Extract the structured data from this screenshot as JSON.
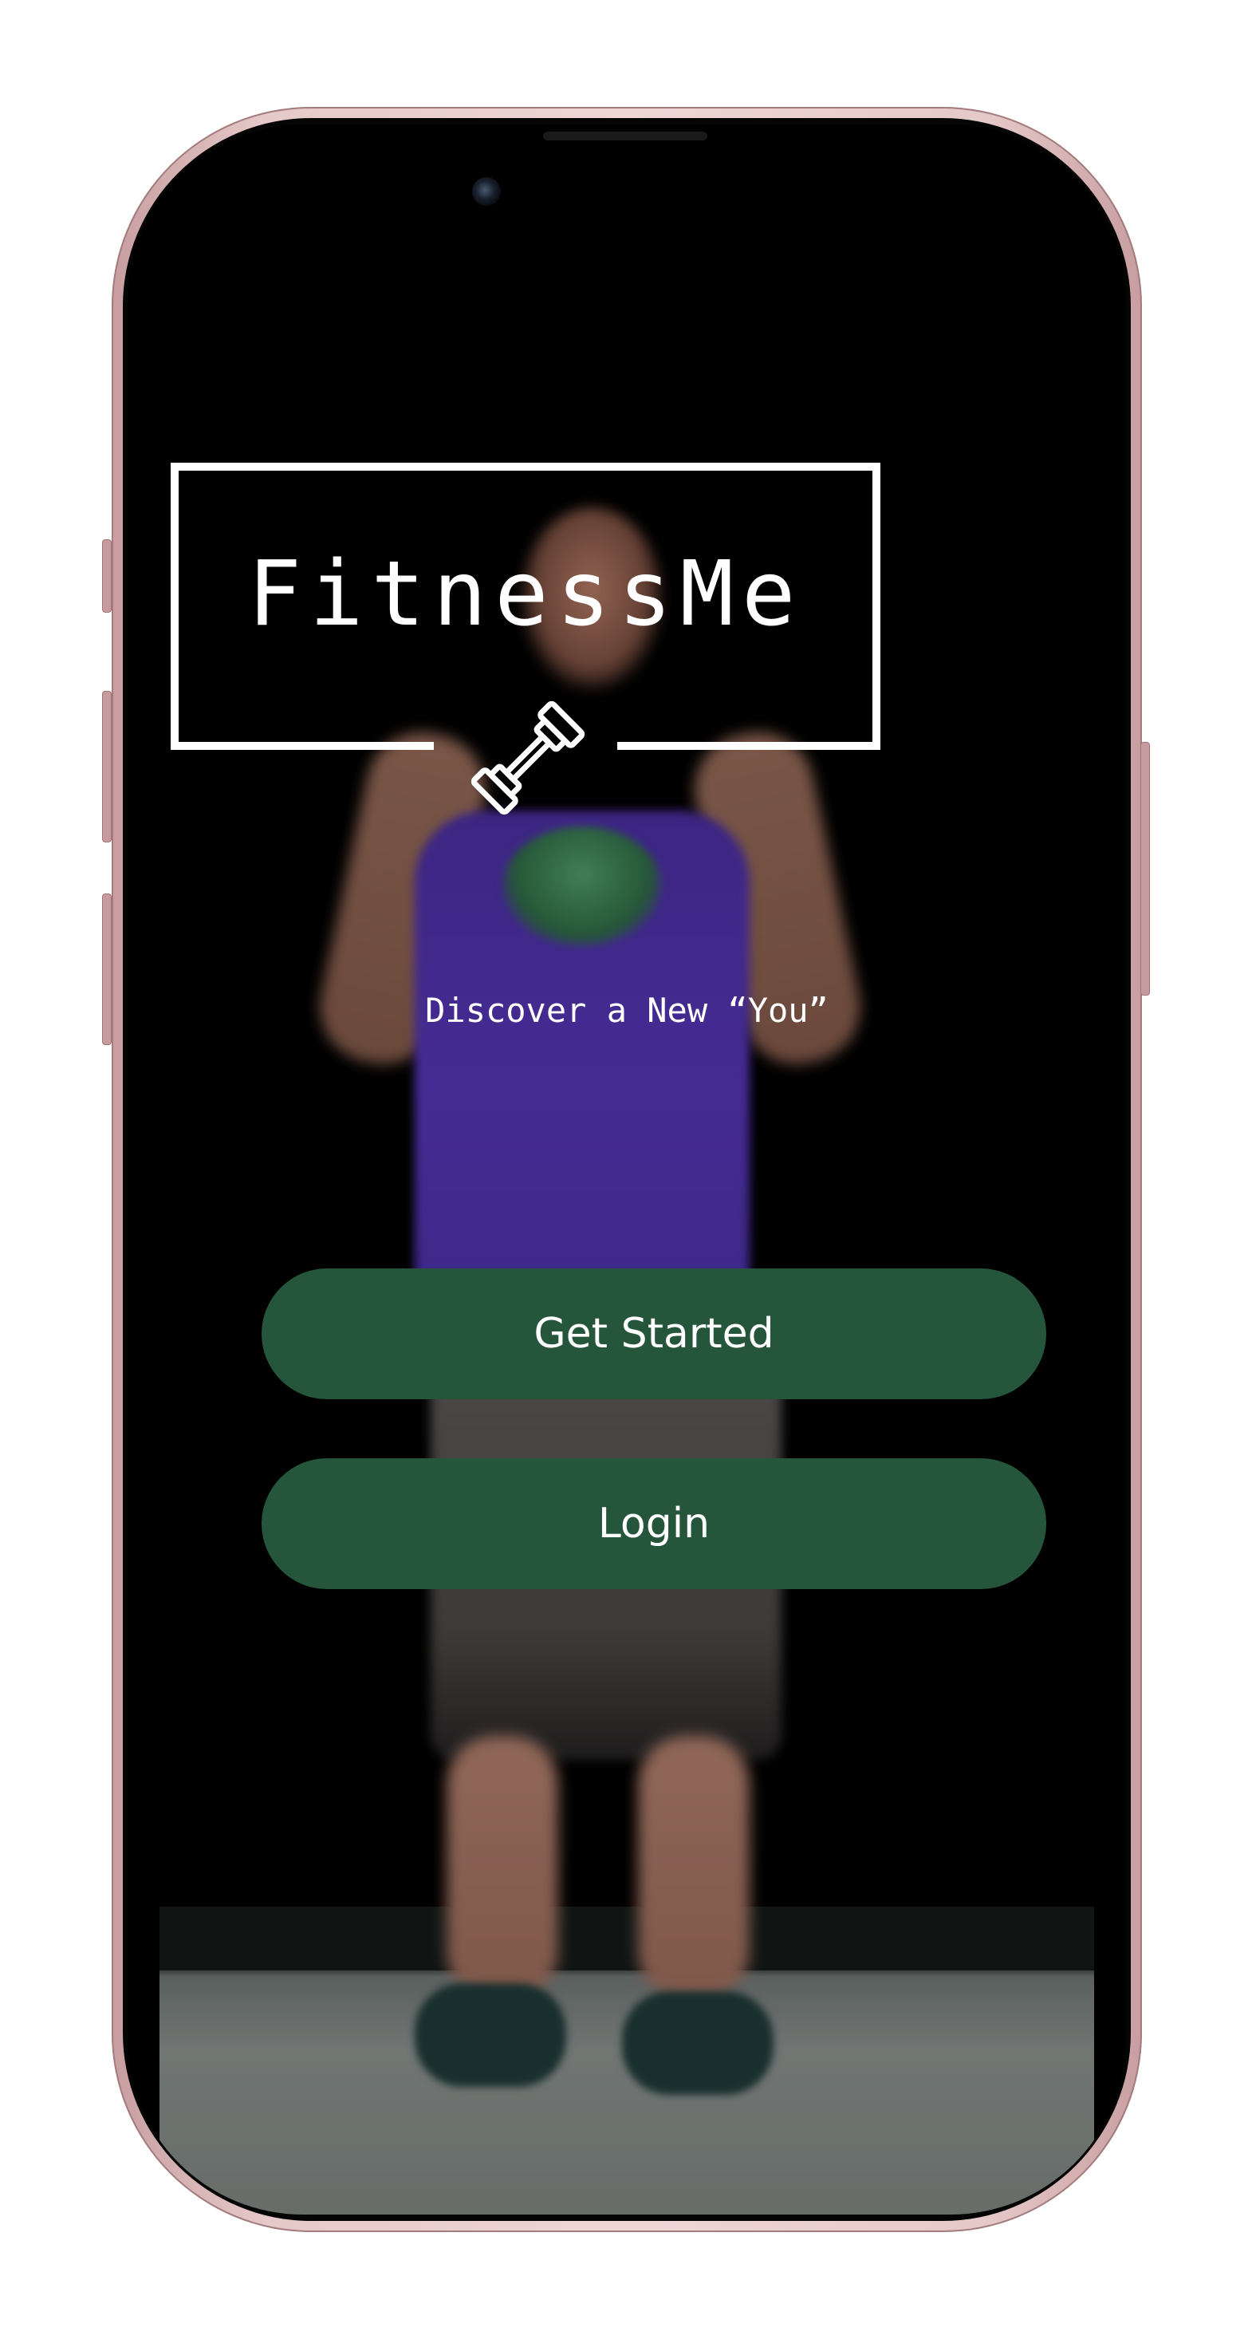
{
  "app": {
    "title": "FitnessMe",
    "tagline": "Discover a New “You”"
  },
  "actions": {
    "get_started_label": "Get Started",
    "login_label": "Login"
  },
  "colors": {
    "button_bg": "#25553a",
    "button_text": "#ffffff",
    "logo": "#ffffff",
    "device_frame": "#e6c9c9",
    "screen_bg": "#000000"
  },
  "icons": {
    "logo_icon": "dumbbell-icon"
  }
}
